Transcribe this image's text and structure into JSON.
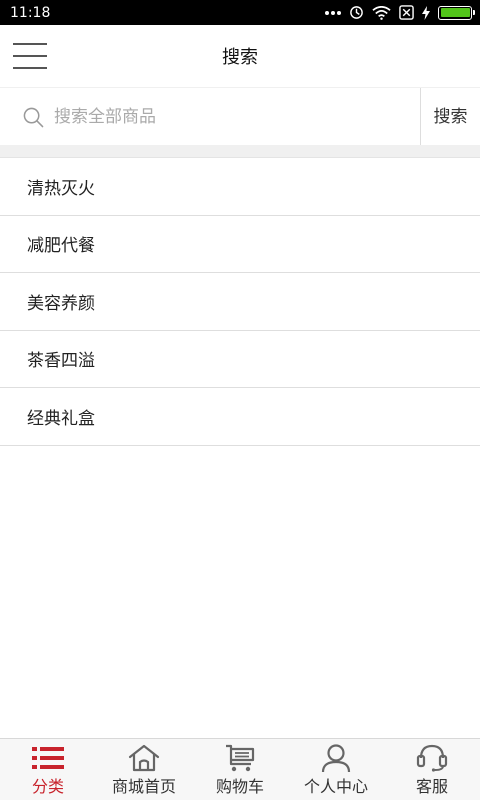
{
  "status_bar": {
    "time": "11:18",
    "battery_color": "#52c41a"
  },
  "header": {
    "title": "搜索",
    "menu_icon": "hamburger-menu-icon"
  },
  "search": {
    "placeholder": "搜索全部商品",
    "value": "",
    "button_label": "搜索"
  },
  "categories": [
    {
      "label": "清热灭火"
    },
    {
      "label": "减肥代餐"
    },
    {
      "label": "美容养颜"
    },
    {
      "label": "茶香四溢"
    },
    {
      "label": "经典礼盒"
    }
  ],
  "tabs": [
    {
      "label": "分类",
      "icon": "list-icon",
      "active": true
    },
    {
      "label": "商城首页",
      "icon": "home-icon",
      "active": false
    },
    {
      "label": "购物车",
      "icon": "cart-icon",
      "active": false
    },
    {
      "label": "个人中心",
      "icon": "user-icon",
      "active": false
    },
    {
      "label": "客服",
      "icon": "headset-icon",
      "active": false
    }
  ],
  "colors": {
    "accent": "#c8232c",
    "icon_gray": "#666666"
  }
}
